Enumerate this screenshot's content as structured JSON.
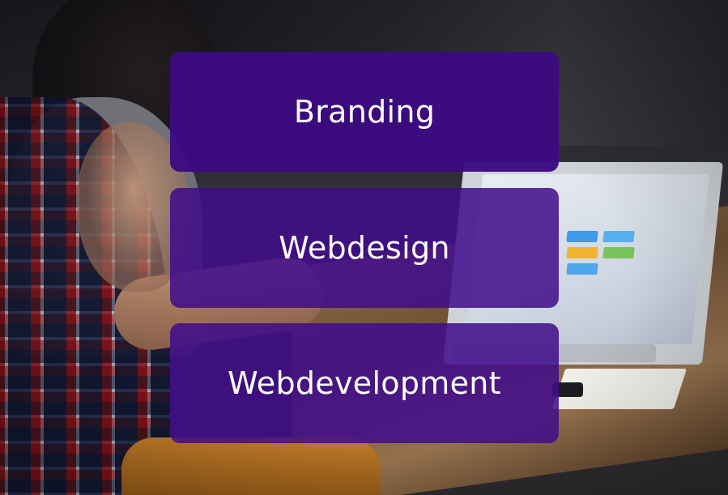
{
  "cards": [
    {
      "label": "Branding"
    },
    {
      "label": "Webdesign"
    },
    {
      "label": "Webdevelopment"
    }
  ],
  "colors": {
    "card_purple": "#3f0c8a",
    "card_text": "#ffffff"
  }
}
